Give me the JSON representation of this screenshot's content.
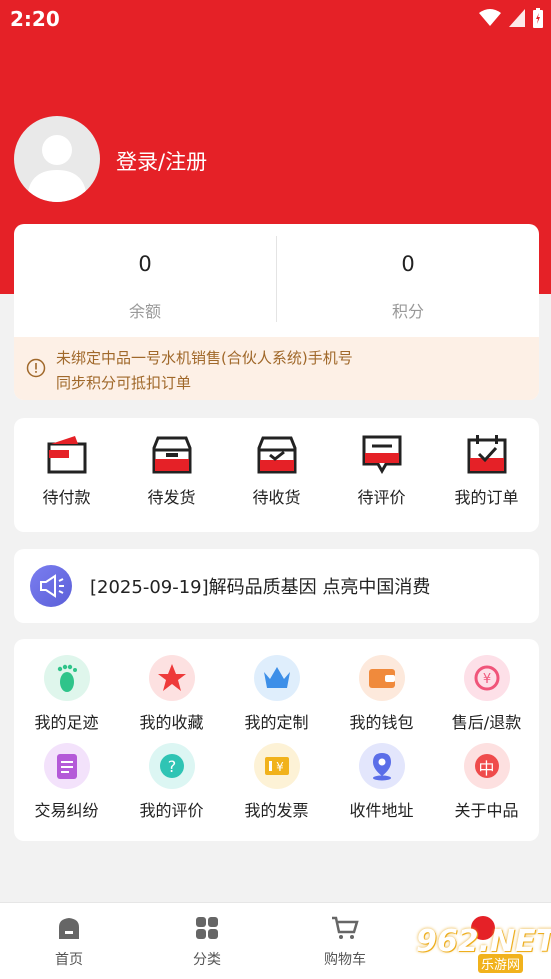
{
  "status_bar": {
    "time": "2:20"
  },
  "profile": {
    "login_label": "登录/注册"
  },
  "balance": {
    "items": [
      {
        "value": "0",
        "label": "余额"
      },
      {
        "value": "0",
        "label": "积分"
      }
    ],
    "notice": {
      "line1": "未绑定中品一号水机销售(合伙人系统)手机号",
      "line2": "同步积分可抵扣订单"
    }
  },
  "orders": [
    {
      "label": "待付款",
      "icon": "wallet-icon"
    },
    {
      "label": "待发货",
      "icon": "box-icon"
    },
    {
      "label": "待收货",
      "icon": "receive-box-icon"
    },
    {
      "label": "待评价",
      "icon": "comment-icon"
    },
    {
      "label": "我的订单",
      "icon": "calendar-check-icon"
    }
  ],
  "news": {
    "text": "[2025-09-19]解码品质基因 点亮中国消费",
    "icon": "megaphone-icon"
  },
  "services": [
    {
      "label": "我的足迹",
      "icon": "footprint-icon",
      "color": "#2fc48a",
      "bg": "#dff6ec"
    },
    {
      "label": "我的收藏",
      "icon": "star-icon",
      "color": "#ee3a3a",
      "bg": "#fde1e1"
    },
    {
      "label": "我的定制",
      "icon": "crown-icon",
      "color": "#3d8fe8",
      "bg": "#dfeefc"
    },
    {
      "label": "我的钱包",
      "icon": "wallet-icon",
      "color": "#f08a3c",
      "bg": "#fde9dc"
    },
    {
      "label": "售后/退款",
      "icon": "refund-icon",
      "color": "#f0557a",
      "bg": "#fde0e8"
    },
    {
      "label": "交易纠纷",
      "icon": "clipboard-icon",
      "color": "#b45ad8",
      "bg": "#f3e2fb"
    },
    {
      "label": "我的评价",
      "icon": "question-icon",
      "color": "#2fc4b4",
      "bg": "#dcf6f3"
    },
    {
      "label": "我的发票",
      "icon": "invoice-icon",
      "color": "#f1b21c",
      "bg": "#fdf2d6"
    },
    {
      "label": "收件地址",
      "icon": "location-icon",
      "color": "#5b6ee8",
      "bg": "#e3e6fc"
    },
    {
      "label": "关于中品",
      "icon": "zhong-icon",
      "color": "#ef4b4b",
      "bg": "#fde0e0",
      "glyph": "中"
    }
  ],
  "tabbar": [
    {
      "label": "首页",
      "icon": "home-icon"
    },
    {
      "label": "分类",
      "icon": "grid-icon"
    },
    {
      "label": "购物车",
      "icon": "cart-icon"
    }
  ],
  "watermark": {
    "text": "962.NET",
    "sub": "乐游网"
  },
  "colors": {
    "brand_red": "#e52127"
  }
}
